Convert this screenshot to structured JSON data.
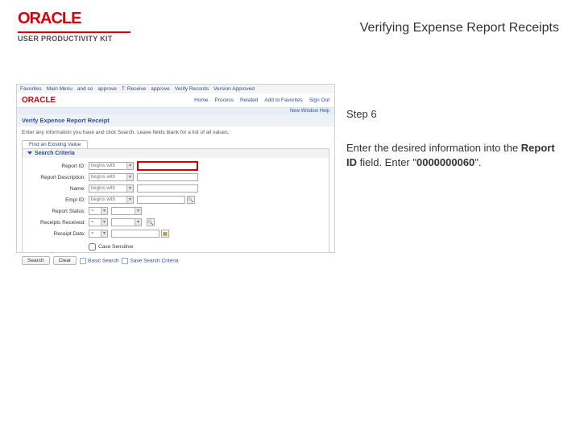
{
  "brand": {
    "name": "ORACLE",
    "subtitle": "USER PRODUCTIVITY KIT"
  },
  "title": "Verifying Expense Report Receipts",
  "instruction": {
    "step_label": "Step 6",
    "lead": "Enter the desired information into the ",
    "field_name": "Report ID",
    "mid": " field. Enter \"",
    "value": "0000000060",
    "tail": "\"."
  },
  "app": {
    "crumbs": [
      "Favorites",
      "Main Menu",
      "and so",
      "approve",
      "T: Receive",
      "approve",
      "Verify Records",
      "Version Approved"
    ],
    "banner_logo": "ORACLE",
    "tabs": [
      "Home",
      "Process",
      "Related",
      "Add to Favorites",
      "Sign Out"
    ],
    "smallbar": "New Window   Help",
    "section_title": "Verify Expense Report Receipt",
    "note": "Enter any information you have and click Search. Leave fields blank for a list of all values.",
    "tab_label": "Find an Existing Value",
    "search_header": "Search Criteria",
    "criteria": [
      {
        "label": "Report ID:",
        "op": "begins with",
        "input_w": 76,
        "hl": true
      },
      {
        "label": "Report Description:",
        "op": "begins with",
        "input_w": 76
      },
      {
        "label": "Name:",
        "op": "begins with",
        "input_w": 76
      },
      {
        "label": "Empl ID:",
        "op": "begins with",
        "input_w": 60,
        "mag": true
      },
      {
        "label": "Report Status:",
        "op": "=",
        "input_w": 38,
        "dd": true
      },
      {
        "label": "Receipts Received:",
        "op": "=",
        "input_w": 38,
        "dd": true,
        "mag": true
      },
      {
        "label": "Receipt Date:",
        "op": "=",
        "input_w": 60,
        "cal": true
      }
    ],
    "case_label": "Case Sensitive",
    "actions": {
      "search": "Search",
      "clear": "Clear",
      "basic": "Basic Search",
      "save": "Save Search Criteria"
    }
  }
}
